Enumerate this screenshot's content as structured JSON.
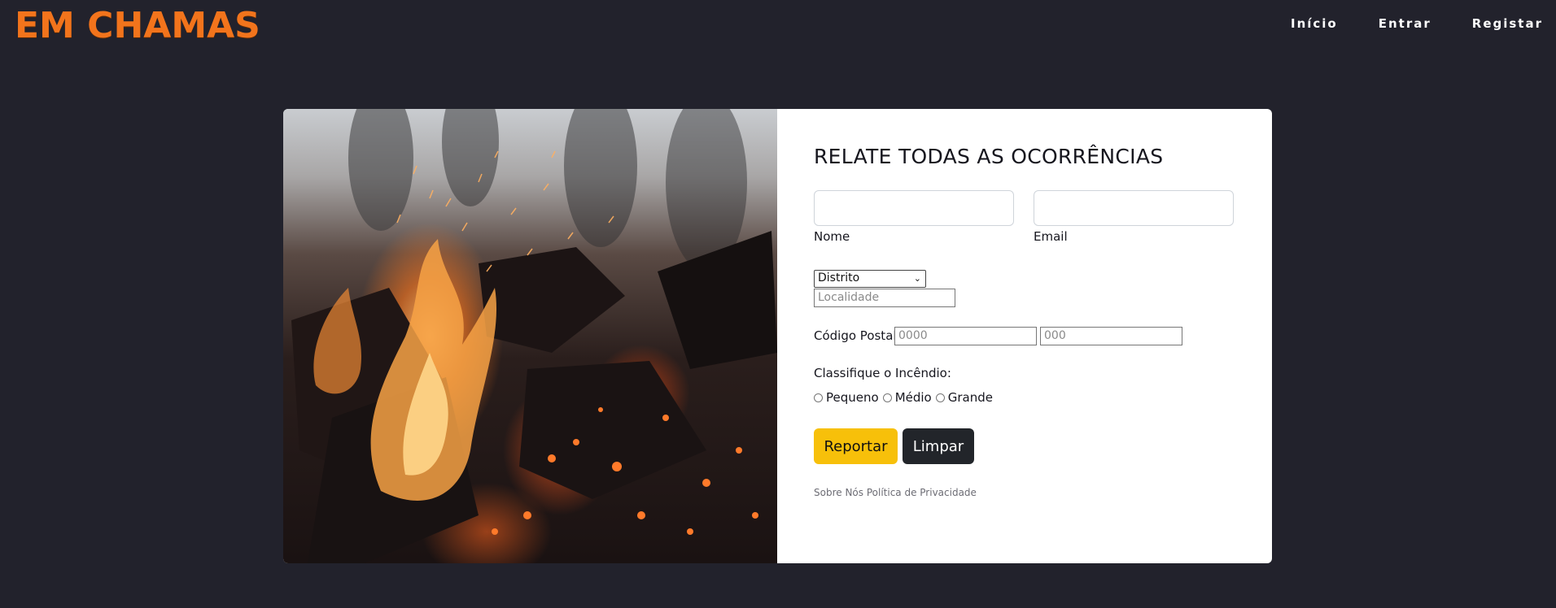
{
  "header": {
    "brand": "EM CHAMAS",
    "nav": [
      "Início",
      "Entrar",
      "Registar"
    ]
  },
  "form": {
    "title": "RELATE TODAS AS OCORRÊNCIAS",
    "name_label": "Nome",
    "email_label": "Email",
    "district_selected": "Distrito",
    "locality_placeholder": "Localidade",
    "postal_label": "Código Postal:",
    "postal_first_placeholder": "0000",
    "postal_second_placeholder": "000",
    "classify_label": "Classifique o Incêndio:",
    "options": [
      "Pequeno",
      "Médio",
      "Grande"
    ],
    "report_button": "Reportar",
    "clear_button": "Limpar",
    "footer_links": [
      "Sobre Nós",
      "Política de Privacidade"
    ]
  },
  "colors": {
    "background": "#22222c",
    "brand": "#f2741c",
    "report_button": "#f7c00a",
    "clear_button": "#22252a"
  }
}
